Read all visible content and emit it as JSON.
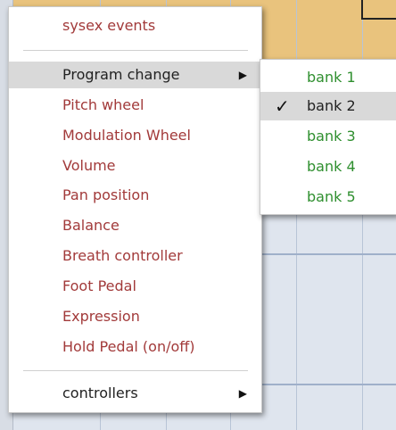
{
  "main_menu": {
    "items": [
      {
        "label": "sysex events"
      },
      {
        "label": "Program change",
        "submenu_arrow": "right-arrow-icon",
        "highlighted": true
      },
      {
        "label": "Pitch wheel"
      },
      {
        "label": "Modulation Wheel"
      },
      {
        "label": "Volume"
      },
      {
        "label": "Pan position"
      },
      {
        "label": "Balance"
      },
      {
        "label": "Breath controller"
      },
      {
        "label": "Foot Pedal"
      },
      {
        "label": "Expression"
      },
      {
        "label": "Hold Pedal (on/off)"
      },
      {
        "label": "controllers",
        "submenu_arrow": "right-arrow-icon"
      }
    ]
  },
  "sub_menu": {
    "items": [
      {
        "label": "bank 1"
      },
      {
        "label": "bank 2",
        "checked": true
      },
      {
        "label": "bank 3"
      },
      {
        "label": "bank 4"
      },
      {
        "label": "bank 5"
      }
    ],
    "check_glyph": "✓"
  },
  "glyphs": {
    "submenu_arrow": "▶"
  },
  "colors": {
    "item_text": "#a23a3a",
    "bank_text": "#2f8f2f",
    "highlight": "#d9d9d9"
  }
}
